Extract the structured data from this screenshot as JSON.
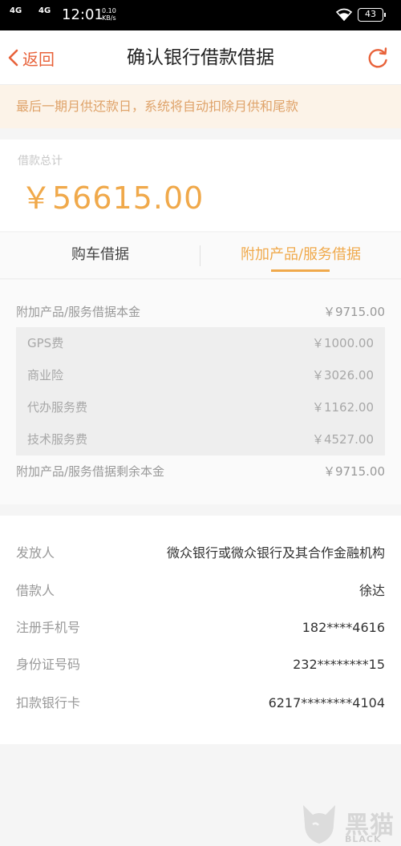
{
  "status_bar": {
    "network1": "4G",
    "network2": "4G",
    "time": "12:01",
    "speed_value": "0.10",
    "speed_unit": "KB/s",
    "battery": "43"
  },
  "nav": {
    "back_label": "返回",
    "title": "确认银行借款借据"
  },
  "notice": "最后一期月供还款日，系统将自动扣除月供和尾款",
  "total": {
    "label": "借款总计",
    "amount": "￥56615.00"
  },
  "tabs": [
    {
      "label": "购车借据",
      "active": false
    },
    {
      "label": "附加产品/服务借据",
      "active": true
    }
  ],
  "detail": {
    "principal": {
      "label": "附加产品/服务借据本金",
      "value": "￥9715.00"
    },
    "items": [
      {
        "label": "GPS费",
        "value": "￥1000.00"
      },
      {
        "label": "商业险",
        "value": "￥3026.00"
      },
      {
        "label": "代办服务费",
        "value": "￥1162.00"
      },
      {
        "label": "技术服务费",
        "value": "￥4527.00"
      }
    ],
    "remaining": {
      "label": "附加产品/服务借据剩余本金",
      "value": "￥9715.00"
    }
  },
  "info": [
    {
      "label": "发放人",
      "value": "微众银行或微众银行及其合作金融机构"
    },
    {
      "label": "借款人",
      "value": "徐达"
    },
    {
      "label": "注册手机号",
      "value": "182****4616"
    },
    {
      "label": "身份证号码",
      "value": "232********15"
    },
    {
      "label": "扣款银行卡",
      "value": "6217********4104"
    }
  ],
  "watermark": {
    "text": "黑猫",
    "sub": "BLACK CAT"
  },
  "colors": {
    "accent": "#f0a94b",
    "back": "#e8623a",
    "notice_bg": "#fcf3e8",
    "notice_text": "#dfa36a"
  },
  "icons": [
    "signal-icon",
    "wifi-icon",
    "battery-icon",
    "back-chevron-icon",
    "refresh-icon",
    "cat-logo-icon"
  ]
}
